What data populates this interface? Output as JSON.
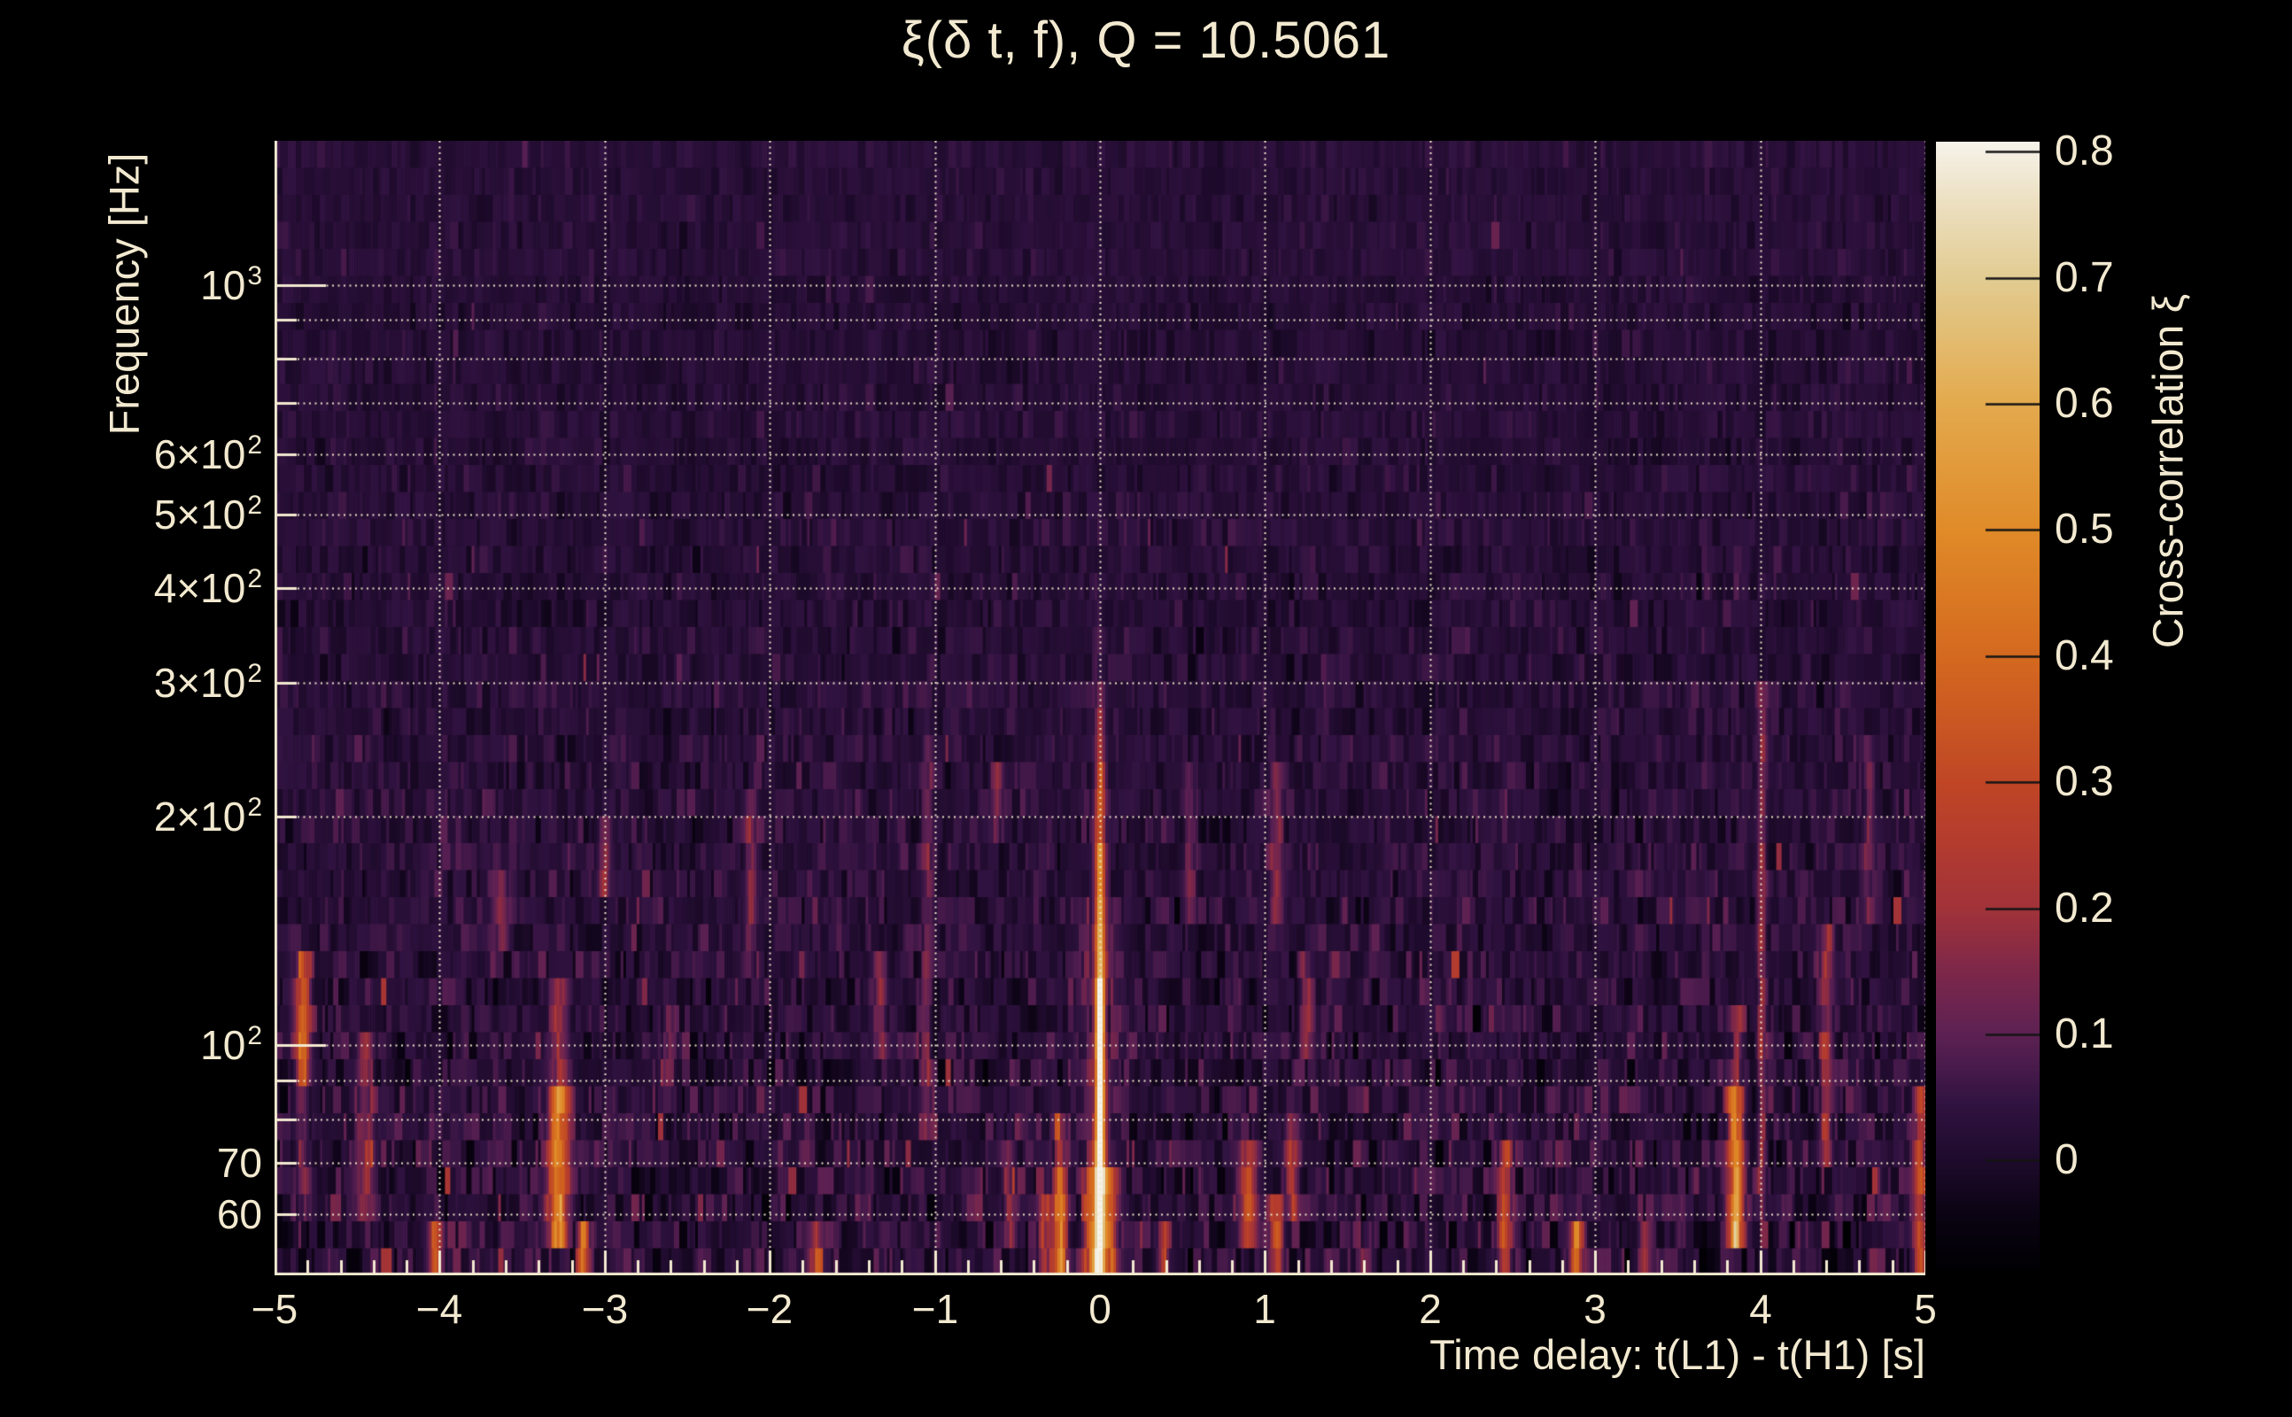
{
  "title": "ξ(δ t, f), Q = 10.5061",
  "axes": {
    "x": {
      "title": "Time delay: t(L1) - t(H1) [s]",
      "min": -5,
      "max": 5,
      "minor_step": 0.2,
      "ticks": [
        {
          "v": -5,
          "label": "−5"
        },
        {
          "v": -4,
          "label": "−4"
        },
        {
          "v": -3,
          "label": "−3"
        },
        {
          "v": -2,
          "label": "−2"
        },
        {
          "v": -1,
          "label": "−1"
        },
        {
          "v": 0,
          "label": "0"
        },
        {
          "v": 1,
          "label": "1"
        },
        {
          "v": 2,
          "label": "2"
        },
        {
          "v": 3,
          "label": "3"
        },
        {
          "v": 4,
          "label": "4"
        },
        {
          "v": 5,
          "label": "5"
        }
      ]
    },
    "y": {
      "title": "Frequency [Hz]",
      "scale": "log",
      "min": 49.85,
      "max": 1549,
      "tick_labels": [
        {
          "f": 1000,
          "text": "10",
          "exp": "3"
        },
        {
          "f": 600,
          "text": "6×10",
          "exp": "2"
        },
        {
          "f": 500,
          "text": "5×10",
          "exp": "2"
        },
        {
          "f": 400,
          "text": "4×10",
          "exp": "2"
        },
        {
          "f": 300,
          "text": "3×10",
          "exp": "2"
        },
        {
          "f": 200,
          "text": "2×10",
          "exp": "2"
        },
        {
          "f": 100,
          "text": "10",
          "exp": "2"
        },
        {
          "f": 70,
          "text": "70",
          "exp": ""
        },
        {
          "f": 60,
          "text": "60",
          "exp": ""
        }
      ],
      "minor_ticks": [
        900,
        800,
        700,
        90,
        80
      ],
      "gridlines": [
        1000,
        900,
        800,
        700,
        600,
        500,
        400,
        300,
        200,
        100,
        90,
        80,
        70,
        60
      ]
    },
    "z": {
      "title": "Cross-correlation ξ",
      "min": -0.089,
      "max": 0.808,
      "ticks": [
        {
          "v": 0.8,
          "label": "0.8"
        },
        {
          "v": 0.7,
          "label": "0.7"
        },
        {
          "v": 0.6,
          "label": "0.6"
        },
        {
          "v": 0.5,
          "label": "0.5"
        },
        {
          "v": 0.4,
          "label": "0.4"
        },
        {
          "v": 0.3,
          "label": "0.3"
        },
        {
          "v": 0.2,
          "label": "0.2"
        },
        {
          "v": 0.1,
          "label": "0.1"
        },
        {
          "v": 0,
          "label": "0"
        }
      ]
    }
  },
  "colors": {
    "background": "#000000",
    "text": "#f2e9d0",
    "axis": "#f2e9d0",
    "grid": "#efe6cc",
    "colorbar_tick": "#141414",
    "colormap": [
      [
        0.0,
        "#000002"
      ],
      [
        0.05,
        "#0a0312"
      ],
      [
        0.095,
        "#1c0a29"
      ],
      [
        0.15,
        "#311341"
      ],
      [
        0.21,
        "#5c2153"
      ],
      [
        0.265,
        "#7c274a"
      ],
      [
        0.32,
        "#a0323a"
      ],
      [
        0.375,
        "#b23b30"
      ],
      [
        0.43,
        "#bf4526"
      ],
      [
        0.545,
        "#d4691f"
      ],
      [
        0.655,
        "#e08a28"
      ],
      [
        0.77,
        "#e3aa4e"
      ],
      [
        0.88,
        "#e2cc92"
      ],
      [
        0.945,
        "#ecdfc0"
      ],
      [
        1.0,
        "#f6f3ea"
      ]
    ]
  },
  "chart_data": {
    "type": "heatmap",
    "description": "Q-transform cross-correlation spectrogram: dark purple noise background with vertical striations, bright yellow-white correlation ridge at zero time delay below ~300 Hz, scattered warm transient columns at low frequency.",
    "x_range": [
      -5,
      5
    ],
    "f_range": [
      49.85,
      1549
    ],
    "z_range": [
      -0.089,
      0.808
    ],
    "rows": 42,
    "cols": 620,
    "seed": 1234,
    "noise": {
      "base": 0.02,
      "sigma_top": 0.013,
      "sigma_low_extra": 0.03,
      "row_jitter": 0.012,
      "col_bias": 0.006,
      "spike_p": 0.006,
      "spike_p_low": 0.025
    },
    "main_peak": {
      "t": 0.0,
      "sigma_t": 0.02,
      "bands": [
        [
          50,
          120,
          0.85
        ],
        [
          120,
          180,
          0.55
        ],
        [
          180,
          230,
          0.35
        ],
        [
          230,
          280,
          0.2
        ],
        [
          280,
          310,
          0.12
        ],
        [
          310,
          420,
          0.04
        ]
      ],
      "wings": {
        "offsets": [
          -0.055,
          0.055
        ],
        "sigma": 0.03,
        "amp": 0.3,
        "f_max": 68
      },
      "glow": {
        "sigma": 0.09,
        "amp": 0.07,
        "f_max": 160
      }
    },
    "features": [
      {
        "t": -4.83,
        "f0": 90,
        "f1": 128,
        "amp": 0.34,
        "sig": 0.03
      },
      {
        "t": -4.83,
        "f0": 60,
        "f1": 90,
        "amp": 0.12,
        "sig": 0.03
      },
      {
        "t": -4.45,
        "f0": 58,
        "f1": 105,
        "amp": 0.16,
        "sig": 0.035
      },
      {
        "t": -4.02,
        "f0": 50,
        "f1": 58,
        "amp": 0.32,
        "sig": 0.03
      },
      {
        "t": -3.62,
        "f0": 135,
        "f1": 165,
        "amp": 0.1,
        "sig": 0.03
      },
      {
        "t": -3.28,
        "f0": 52,
        "f1": 90,
        "amp": 0.45,
        "sig": 0.038
      },
      {
        "t": -3.28,
        "f0": 90,
        "f1": 122,
        "amp": 0.15,
        "sig": 0.038
      },
      {
        "t": -3.13,
        "f0": 50,
        "f1": 57,
        "amp": 0.38,
        "sig": 0.028
      },
      {
        "t": -3.0,
        "f0": 160,
        "f1": 205,
        "amp": 0.14,
        "sig": 0.028
      },
      {
        "t": -2.62,
        "f0": 90,
        "f1": 110,
        "amp": 0.11,
        "sig": 0.028
      },
      {
        "t": -2.12,
        "f0": 125,
        "f1": 215,
        "amp": 0.11,
        "sig": 0.028
      },
      {
        "t": -1.72,
        "f0": 50,
        "f1": 60,
        "amp": 0.14,
        "sig": 0.028
      },
      {
        "t": -1.33,
        "f0": 95,
        "f1": 130,
        "amp": 0.13,
        "sig": 0.026
      },
      {
        "t": -1.05,
        "f0": 75,
        "f1": 260,
        "amp": 0.1,
        "sig": 0.024
      },
      {
        "t": -0.62,
        "f0": 190,
        "f1": 245,
        "amp": 0.12,
        "sig": 0.024
      },
      {
        "t": -0.55,
        "f0": 55,
        "f1": 75,
        "amp": 0.14,
        "sig": 0.026
      },
      {
        "t": -0.33,
        "f0": 50,
        "f1": 62,
        "amp": 0.22,
        "sig": 0.026
      },
      {
        "t": -0.24,
        "f0": 50,
        "f1": 68,
        "amp": 0.42,
        "sig": 0.028
      },
      {
        "t": -0.24,
        "f0": 68,
        "f1": 80,
        "amp": 0.15,
        "sig": 0.028
      },
      {
        "t": 0.38,
        "f0": 50,
        "f1": 58,
        "amp": 0.18,
        "sig": 0.028
      },
      {
        "t": 0.55,
        "f0": 140,
        "f1": 240,
        "amp": 0.1,
        "sig": 0.026
      },
      {
        "t": 0.9,
        "f0": 55,
        "f1": 78,
        "amp": 0.24,
        "sig": 0.03
      },
      {
        "t": 1.07,
        "f0": 50,
        "f1": 62,
        "amp": 0.28,
        "sig": 0.028
      },
      {
        "t": 1.07,
        "f0": 140,
        "f1": 230,
        "amp": 0.12,
        "sig": 0.028
      },
      {
        "t": 1.16,
        "f0": 60,
        "f1": 80,
        "amp": 0.18,
        "sig": 0.028
      },
      {
        "t": 1.25,
        "f0": 95,
        "f1": 135,
        "amp": 0.15,
        "sig": 0.028
      },
      {
        "t": 1.62,
        "f0": 50,
        "f1": 60,
        "amp": 0.15,
        "sig": 0.028
      },
      {
        "t": 2.45,
        "f0": 50,
        "f1": 76,
        "amp": 0.26,
        "sig": 0.03
      },
      {
        "t": 2.89,
        "f0": 50,
        "f1": 57,
        "amp": 0.42,
        "sig": 0.026
      },
      {
        "t": 3.3,
        "f0": 50,
        "f1": 58,
        "amp": 0.15,
        "sig": 0.026
      },
      {
        "t": 3.85,
        "f0": 55,
        "f1": 92,
        "amp": 0.45,
        "sig": 0.034
      },
      {
        "t": 3.85,
        "f0": 92,
        "f1": 115,
        "amp": 0.12,
        "sig": 0.034
      },
      {
        "t": 4.01,
        "f0": 60,
        "f1": 300,
        "amp": 0.15,
        "sig": 0.018
      },
      {
        "t": 4.4,
        "f0": 68,
        "f1": 150,
        "amp": 0.17,
        "sig": 0.03
      },
      {
        "t": 4.65,
        "f0": 145,
        "f1": 250,
        "amp": 0.1,
        "sig": 0.026
      },
      {
        "t": 4.97,
        "f0": 50,
        "f1": 90,
        "amp": 0.22,
        "sig": 0.026
      }
    ]
  }
}
